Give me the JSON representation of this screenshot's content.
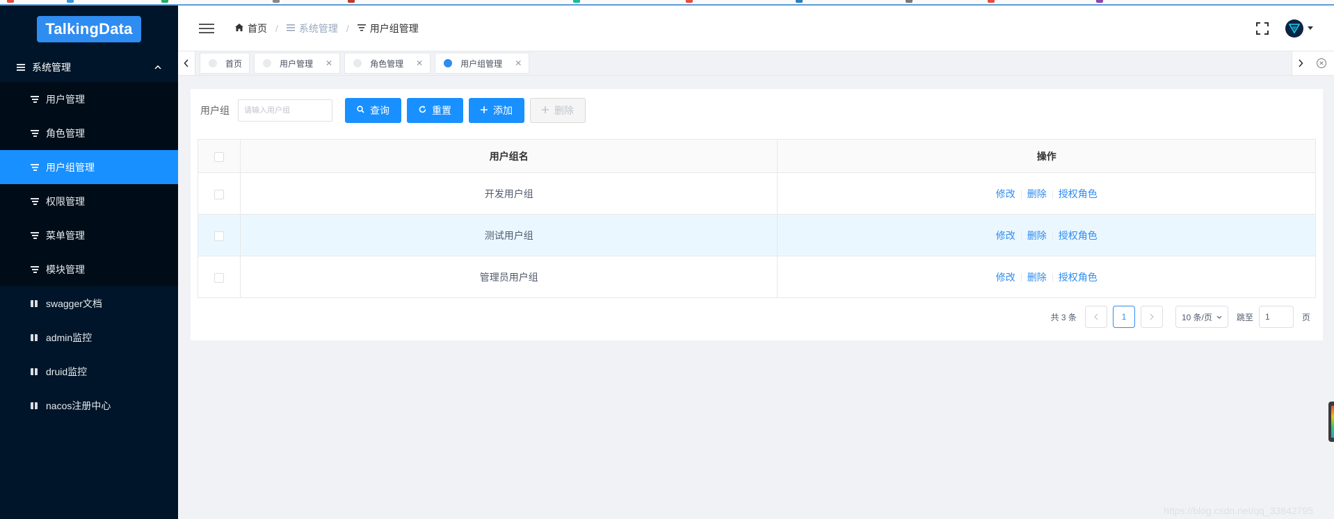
{
  "app": {
    "logo_text": "TalkingData"
  },
  "sidebar": {
    "group_label": "系统管理",
    "items": [
      {
        "label": "用户管理",
        "icon": "filter-icon",
        "active": false
      },
      {
        "label": "角色管理",
        "icon": "filter-icon",
        "active": false
      },
      {
        "label": "用户组管理",
        "icon": "filter-icon",
        "active": true
      },
      {
        "label": "权限管理",
        "icon": "filter-icon",
        "active": false
      },
      {
        "label": "菜单管理",
        "icon": "filter-icon",
        "active": false
      },
      {
        "label": "模块管理",
        "icon": "filter-icon",
        "active": false
      },
      {
        "label": "swagger文档",
        "icon": "book-icon",
        "active": false
      },
      {
        "label": "admin监控",
        "icon": "book-icon",
        "active": false
      },
      {
        "label": "druid监控",
        "icon": "book-icon",
        "active": false
      },
      {
        "label": "nacos注册中心",
        "icon": "book-icon",
        "active": false
      }
    ]
  },
  "header": {
    "breadcrumb": [
      {
        "label": "首页",
        "icon": "home-icon"
      },
      {
        "label": "系统管理",
        "icon": "list-icon"
      },
      {
        "label": "用户组管理",
        "icon": "filter-icon"
      }
    ]
  },
  "tabs": [
    {
      "label": "首页",
      "closable": false,
      "active": false
    },
    {
      "label": "用户管理",
      "closable": true,
      "active": false
    },
    {
      "label": "角色管理",
      "closable": true,
      "active": false
    },
    {
      "label": "用户组管理",
      "closable": true,
      "active": true
    }
  ],
  "search": {
    "label": "用户组",
    "placeholder": "请输入用户组",
    "value": "",
    "buttons": {
      "query": "查询",
      "reset": "重置",
      "add": "添加",
      "delete": "删除"
    }
  },
  "table": {
    "columns": [
      "用户组名",
      "操作"
    ],
    "rows": [
      {
        "name": "开发用户组"
      },
      {
        "name": "测试用户组"
      },
      {
        "name": "管理员用户组"
      }
    ],
    "actions": {
      "edit": "修改",
      "delete": "删除",
      "grant": "授权角色"
    }
  },
  "pagination": {
    "total_text": "共 3 条",
    "current_page": "1",
    "page_size": "10 条/页",
    "jump_label": "跳至",
    "jump_value": "1",
    "page_suffix": "页"
  },
  "watermark": "https://blog.csdn.net/qq_33842795",
  "colors": {
    "primary": "#1890ff",
    "sidebar_bg": "#001529",
    "link": "#2d8cf0"
  }
}
